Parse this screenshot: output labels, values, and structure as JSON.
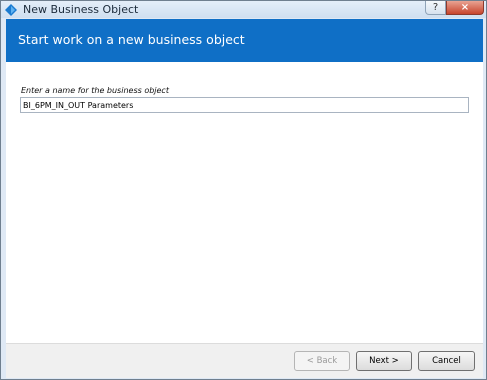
{
  "window": {
    "title": "New Business Object",
    "help_glyph": "?",
    "close_glyph": "×"
  },
  "banner": {
    "heading": "Start work on a new business object"
  },
  "form": {
    "name_label": "Enter a name for the business object",
    "name_value": "BI_6PM_IN_OUT Parameters"
  },
  "footer": {
    "back_label": "< Back",
    "next_label": "Next >",
    "cancel_label": "Cancel"
  },
  "colors": {
    "banner": "#0f6fc6",
    "close_button": "#c7442c"
  },
  "icons": {
    "app": "business-object-icon",
    "help": "help-icon",
    "close": "close-icon"
  }
}
